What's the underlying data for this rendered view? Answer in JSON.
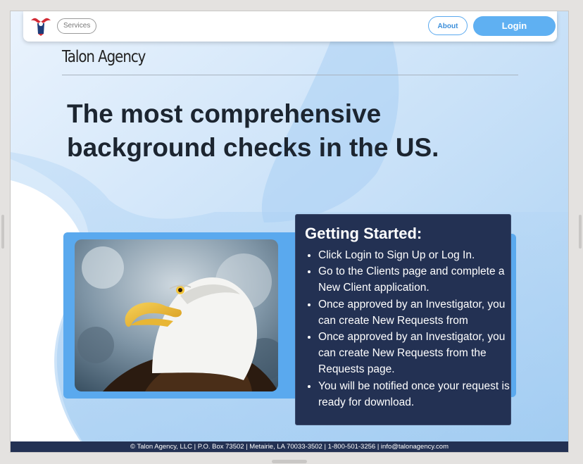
{
  "navbar": {
    "services_label": "Services",
    "about_label": "About",
    "login_label": "Login"
  },
  "agency": {
    "title": "Talon Agency"
  },
  "hero": {
    "line1": "The most comprehensive",
    "line2": "background checks in the US."
  },
  "getting_started": {
    "heading": "Getting Started:",
    "items": [
      "Click Login to Sign Up or Log In.",
      "Go to the Clients page and complete a New Client application.",
      "Once approved by an Investigator, you can create New Requests from",
      "Once approved by an Investigator, you can create New Requests from the Requests page.",
      "You will be notified once your request is ready for download."
    ]
  },
  "footer": {
    "text": "© Talon Agency, LLC | P.O. Box 73502 | Metairie, LA 70033-3502 | 1-800-501-3256 | info@talonagency.com"
  },
  "icons": {
    "logo": "eagle-logo",
    "photo": "bald-eagle-photo"
  },
  "colors": {
    "accent_blue": "#5fb0f2",
    "navy": "#233153",
    "frame_blue": "#5aa9ee"
  }
}
